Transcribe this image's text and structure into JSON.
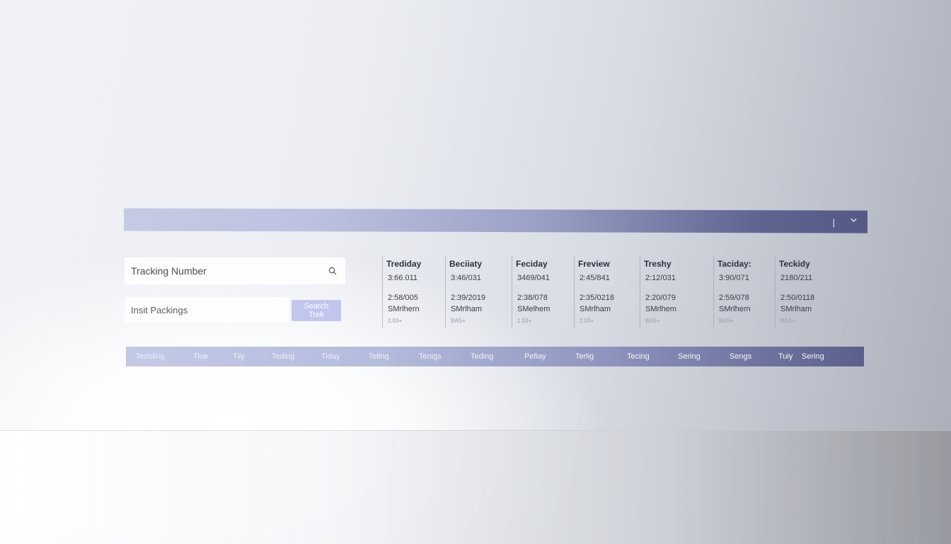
{
  "header": {
    "separator": "|",
    "collapse_icon": "chevron-down-icon",
    "accent_color": "#5f6591"
  },
  "search": {
    "label": "Tracking Number",
    "icon": "search-icon"
  },
  "packing": {
    "label": "Insit Packings",
    "button_label": "Search Trek",
    "button_color": "#c2c5ec"
  },
  "columns": [
    {
      "header": "Trediday",
      "value1": "3:66.011",
      "value2": "2:58/005",
      "value3": "SMrlhern",
      "value4": "2.03+"
    },
    {
      "header": "Beciiaty",
      "value1": "3:46/031",
      "value2": "2:39/2019",
      "value3": "SMrlham",
      "value4": "BAS+"
    },
    {
      "header": "Feciday",
      "value1": "3469/041",
      "value2": "2:38/078",
      "value3": "SMelhem",
      "value4": "1.03+"
    },
    {
      "header": "Freview",
      "value1": "2:45/841",
      "value2": "2:35/0218",
      "value3": "SMrlham",
      "value4": "2.03+"
    },
    {
      "header": "Treshy",
      "value1": "2:12/031",
      "value2": "2:20/079",
      "value3": "SMrlhem",
      "value4": "BAS+"
    },
    {
      "header": "Taciday:",
      "value1": "3:90/071",
      "value2": "2:59/078",
      "value3": "SMrlhern",
      "value4": "BAS+"
    },
    {
      "header": "Teckidy",
      "value1": "2180/211",
      "value2": "2:50/0118",
      "value3": "SMrlham",
      "value4": "BAS+"
    }
  ],
  "tabs": [
    "Terisling",
    "Tiue",
    "Tiiy",
    "Teding",
    "Tiday",
    "Teling",
    "Tenigs",
    "Teding",
    "Pefiay",
    "Terlig",
    "Tecing",
    "Sering",
    "Sengs",
    "Tuiy",
    "Sering"
  ]
}
